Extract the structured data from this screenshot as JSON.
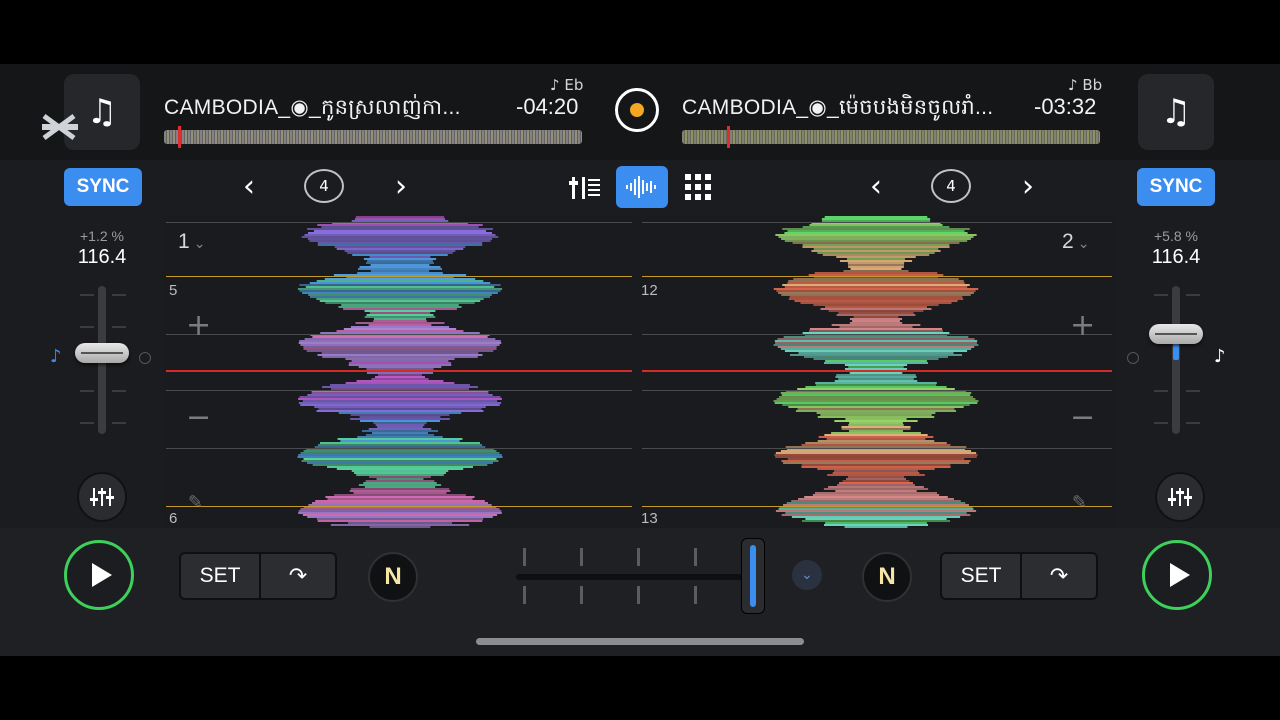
{
  "deck_left": {
    "title": "CAMBODIA_◉_កូនស្រលាញ់កា...",
    "time_remaining": "-04:20",
    "key": "♪ Eb",
    "deck_number": "1",
    "pitch_percent": "+1.2 %",
    "bpm": "116.4",
    "beat_top": "5",
    "beat_bottom": "6",
    "loop_size": "4",
    "sync_label": "SYNC",
    "set_label": "SET"
  },
  "deck_right": {
    "title": "CAMBODIA_◉_ម៉េចបងមិនចូលរាំ...",
    "time_remaining": "-03:32",
    "key": "♪ Bb",
    "deck_number": "2",
    "pitch_percent": "+5.8 %",
    "bpm": "116.4",
    "beat_top": "12",
    "beat_bottom": "13",
    "loop_size": "4",
    "sync_label": "SYNC",
    "set_label": "SET"
  },
  "icons": {
    "album_art": "♫",
    "chevron_left": "‹",
    "chevron_right": "›",
    "mixer": "⫶⫶⫶",
    "waveform_view": "|||",
    "pads_grid": "▦",
    "eq": "⫶",
    "jump": "↷",
    "n_logo": "N",
    "plus": "+",
    "minus": "−",
    "pencil": "✎",
    "note": "♪",
    "dropdown": "⌄",
    "capcut": "⌘"
  },
  "colors": {
    "accent": "#3c8df0",
    "play_ring": "#3dd05a",
    "playhead": "#e12b33",
    "beat_marker": "#c49a2a"
  },
  "crossfader_position": 0.99
}
